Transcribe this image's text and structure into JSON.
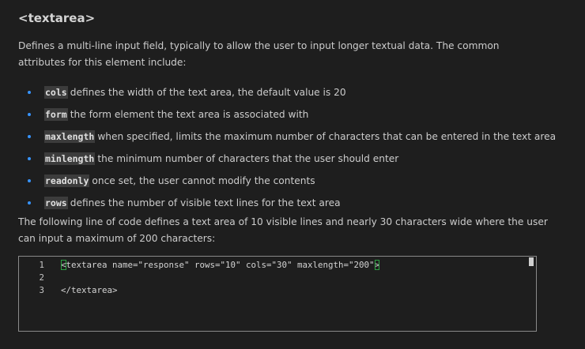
{
  "title": "<textarea>",
  "intro": "Defines a multi-line input field, typically to allow the user to input longer textual data. The common attributes for this element include:",
  "attributes": [
    {
      "code": "cols",
      "desc": "defines the width of the text area, the default value is 20"
    },
    {
      "code": "form",
      "desc": "the form element the text area is associated with"
    },
    {
      "code": "maxlength",
      "desc": "when specified, limits the maximum number of characters that can be entered in the text area"
    },
    {
      "code": "minlength",
      "desc": "the minimum number of characters that the user should enter"
    },
    {
      "code": "readonly",
      "desc": "once set, the user cannot modify the contents"
    },
    {
      "code": "rows",
      "desc": "defines the number of visible text lines for the text area"
    }
  ],
  "outro": "The following line of code defines a text area of 10 visible lines and nearly 30 characters wide where the user can input a maximum of 200 characters:",
  "code_editor": {
    "lines": [
      {
        "number": "1",
        "open_bracket": "<",
        "text": "textarea name=\"response\" rows=\"10\" cols=\"30\" maxlength=\"200\"",
        "close_bracket": ">"
      },
      {
        "number": "2",
        "text": ""
      },
      {
        "number": "3",
        "text": "</textarea>"
      }
    ]
  },
  "colors": {
    "background": "#1e1e1e",
    "bullet": "#3794ff",
    "bracket_match": "#2ea043"
  }
}
